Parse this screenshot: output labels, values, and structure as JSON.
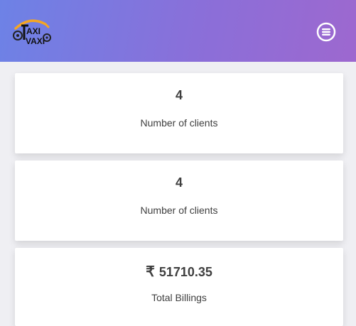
{
  "header": {
    "logo_text_top": "AXI",
    "logo_text_bottom": "VAXI",
    "menu_icon": "menu-circle-icon",
    "gradient_start": "#6d82e6",
    "gradient_end": "#9d68cf"
  },
  "cards": [
    {
      "value": "4",
      "label": "Number of clients"
    },
    {
      "value": "4",
      "label": "Number of clients"
    },
    {
      "currency_symbol": "₹",
      "value": "51710.35",
      "label": "Total Billings"
    }
  ]
}
